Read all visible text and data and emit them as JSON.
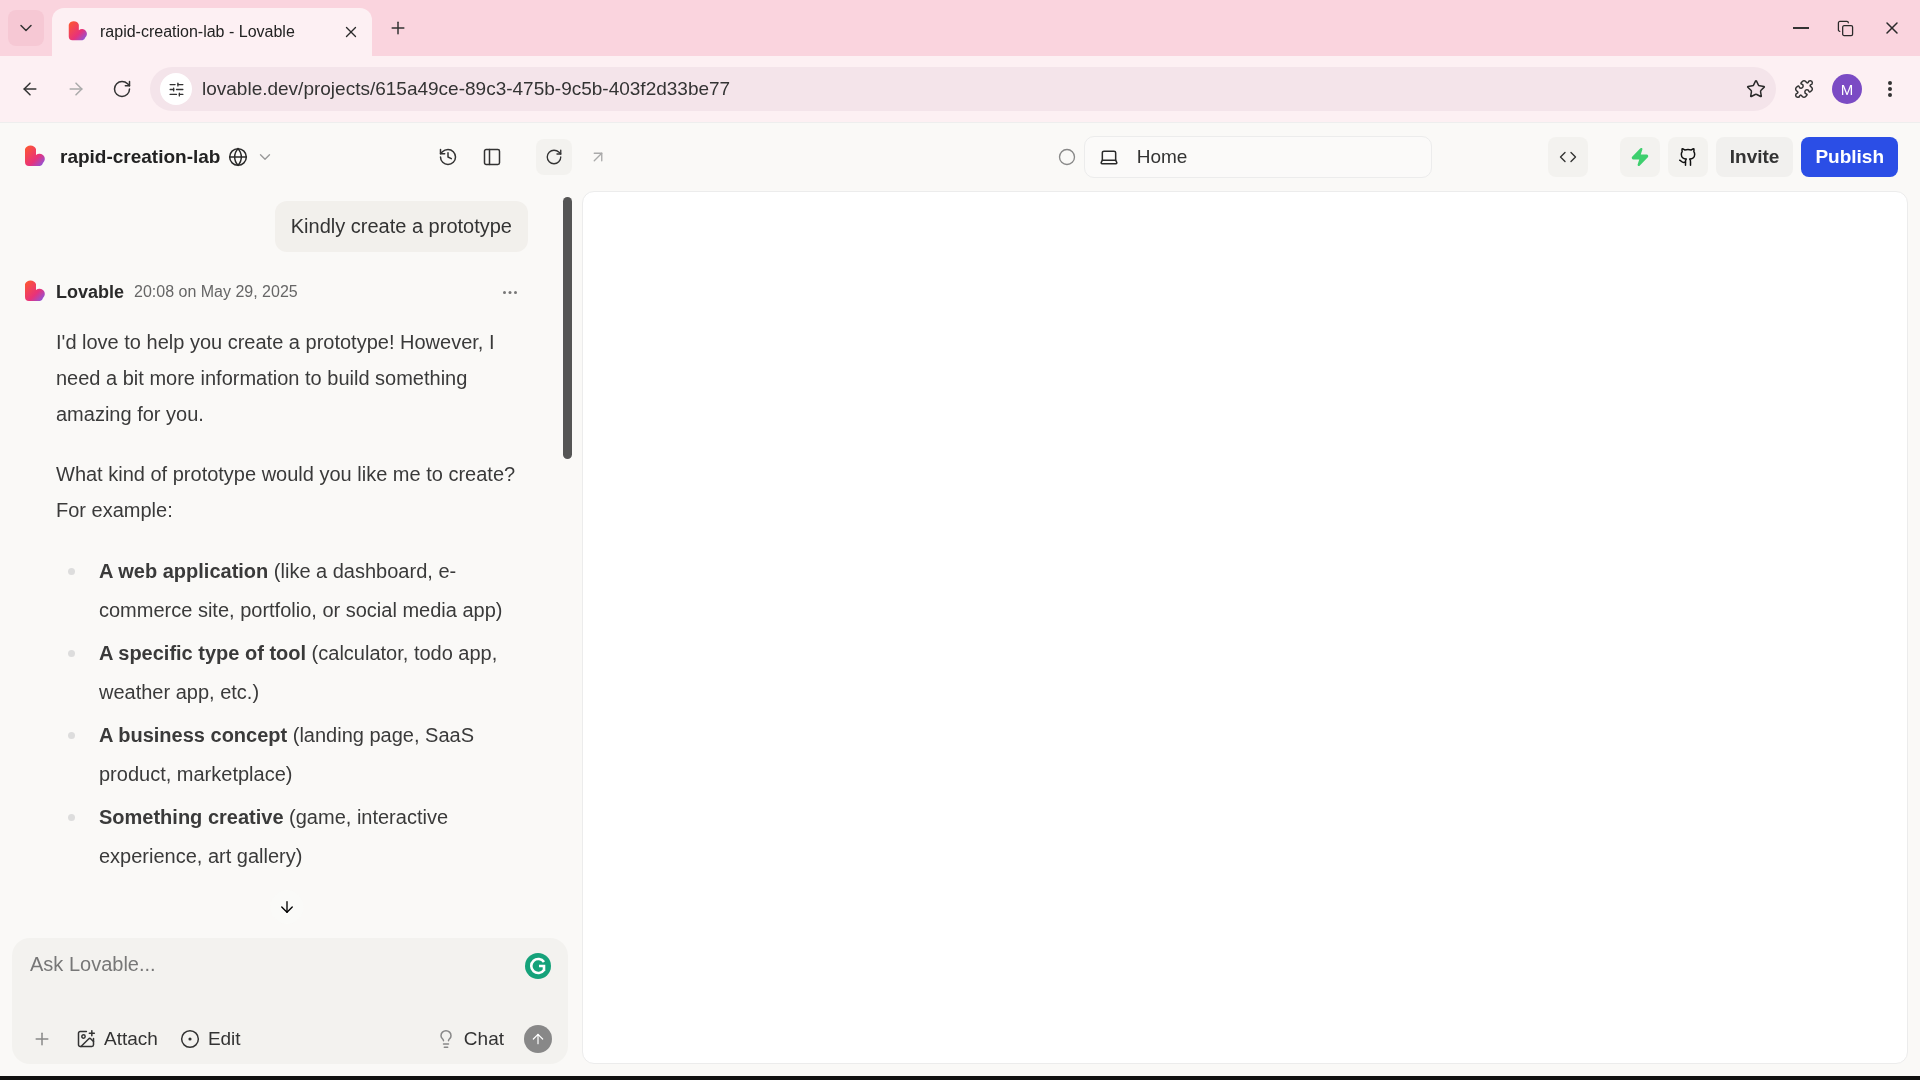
{
  "browser": {
    "tabs": [
      {
        "title": "rapid-creation-lab - Lovable",
        "selected": true
      }
    ],
    "address": "lovable.dev/projects/615a49ce-89c3-475b-9c5b-403f2d33be77",
    "profile_initial": "M"
  },
  "header": {
    "project_name": "rapid-creation-lab",
    "preview_path": "Home",
    "invite": "Invite",
    "publish": "Publish"
  },
  "chat": {
    "user_message": "Kindly create a prototype",
    "reply": {
      "author": "Lovable",
      "time": "20:08 on May 29, 2025",
      "paragraphs": [
        "I'd love to help you create a prototype! However, I need a bit more information to build something amazing for you.",
        "What kind of prototype would you like me to create? For example:"
      ],
      "bullets": [
        "**A web application** (like a dashboard, e-commerce site, portfolio, or social media app)",
        "**A specific type of tool** (calculator, todo app, weather app, etc.)",
        "**A business concept** (landing page, SaaS product, marketplace)",
        "**Something creative** (game, interactive experience, art gallery)"
      ]
    },
    "input": {
      "placeholder": "Ask Lovable..."
    },
    "actions": [
      "Attach",
      "Edit"
    ],
    "mode": "Chat"
  }
}
